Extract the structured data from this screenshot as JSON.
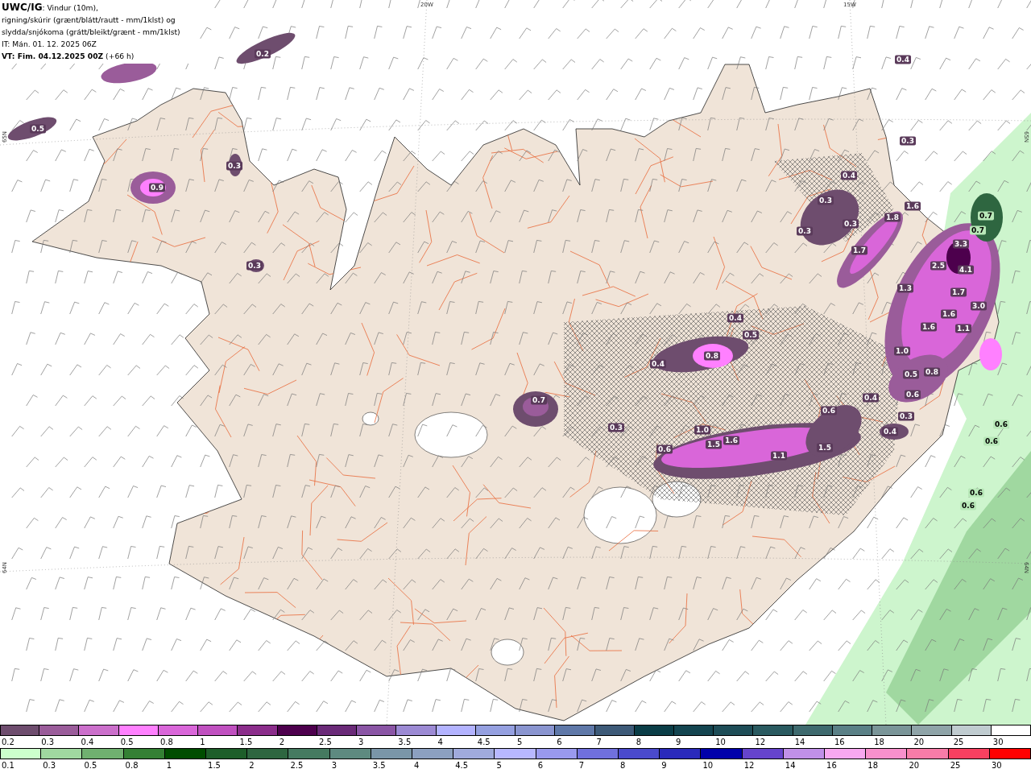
{
  "header": {
    "lines": [
      "**UWC/IG**: Vindur (10m),",
      "rigning/skúrir (grænt/blátt/rautt - mm/1klst) og",
      "slydda/snjókoma (grátt/bleikt/grænt - mm/1klst)",
      "IT: Mán. 01. 12. 2025 06Z",
      "**VT: Fim. 04.12.2025 00Z** (+66 h)"
    ]
  },
  "map": {
    "grid_labels": [
      {
        "text": "20W",
        "kind": "top"
      },
      {
        "text": "15W",
        "kind": "top"
      },
      {
        "text": "65N",
        "kind": "left"
      },
      {
        "text": "64N",
        "kind": "left"
      },
      {
        "text": "65N",
        "kind": "right"
      },
      {
        "text": "64N",
        "kind": "right"
      }
    ],
    "values": [
      {
        "value": "0.2",
        "kind": "snow"
      },
      {
        "value": "0.5",
        "kind": "snow"
      },
      {
        "value": "0.9",
        "kind": "snow"
      },
      {
        "value": "0.3",
        "kind": "snow"
      },
      {
        "value": "0.3",
        "kind": "snow"
      },
      {
        "value": "0.4",
        "kind": "snow"
      },
      {
        "value": "0.3",
        "kind": "snow"
      },
      {
        "value": "0.4",
        "kind": "snow"
      },
      {
        "value": "0.3",
        "kind": "snow"
      },
      {
        "value": "0.3",
        "kind": "snow"
      },
      {
        "value": "0.3",
        "kind": "snow"
      },
      {
        "value": "1.8",
        "kind": "snow"
      },
      {
        "value": "1.6",
        "kind": "snow"
      },
      {
        "value": "1.7",
        "kind": "snow"
      },
      {
        "value": "0.7",
        "kind": "rain"
      },
      {
        "value": "0.7",
        "kind": "rain"
      },
      {
        "value": "3.3",
        "kind": "snow"
      },
      {
        "value": "2.5",
        "kind": "snow"
      },
      {
        "value": "4.1",
        "kind": "snow"
      },
      {
        "value": "1.3",
        "kind": "snow"
      },
      {
        "value": "1.7",
        "kind": "snow"
      },
      {
        "value": "3.0",
        "kind": "snow"
      },
      {
        "value": "1.6",
        "kind": "snow"
      },
      {
        "value": "1.6",
        "kind": "snow"
      },
      {
        "value": "1.1",
        "kind": "snow"
      },
      {
        "value": "0.4",
        "kind": "snow"
      },
      {
        "value": "0.5",
        "kind": "snow"
      },
      {
        "value": "0.8",
        "kind": "snow"
      },
      {
        "value": "0.4",
        "kind": "snow"
      },
      {
        "value": "1.0",
        "kind": "snow"
      },
      {
        "value": "0.5",
        "kind": "snow"
      },
      {
        "value": "0.8",
        "kind": "snow"
      },
      {
        "value": "0.6",
        "kind": "snow"
      },
      {
        "value": "0.7",
        "kind": "snow"
      },
      {
        "value": "0.3",
        "kind": "snow"
      },
      {
        "value": "0.6",
        "kind": "snow"
      },
      {
        "value": "0.4",
        "kind": "snow"
      },
      {
        "value": "0.3",
        "kind": "snow"
      },
      {
        "value": "0.4",
        "kind": "snow"
      },
      {
        "value": "0.6",
        "kind": "rain"
      },
      {
        "value": "0.6",
        "kind": "rain"
      },
      {
        "value": "1.0",
        "kind": "snow"
      },
      {
        "value": "1.5",
        "kind": "snow"
      },
      {
        "value": "1.6",
        "kind": "snow"
      },
      {
        "value": "0.6",
        "kind": "snow"
      },
      {
        "value": "1.1",
        "kind": "snow"
      },
      {
        "value": "1.5",
        "kind": "snow"
      },
      {
        "value": "0.6",
        "kind": "rain"
      },
      {
        "value": "0.6",
        "kind": "rain"
      }
    ]
  },
  "legends": [
    {
      "items": [
        {
          "label": "0.2",
          "color": "#6e4d6e"
        },
        {
          "label": "0.3",
          "color": "#9a5c9a"
        },
        {
          "label": "0.4",
          "color": "#cb6fcb"
        },
        {
          "label": "0.5",
          "color": "#ff80ff"
        },
        {
          "label": "0.8",
          "color": "#d966d9"
        },
        {
          "label": "1",
          "color": "#c050c0"
        },
        {
          "label": "1.5",
          "color": "#8b2d8b"
        },
        {
          "label": "2",
          "color": "#4d004d"
        },
        {
          "label": "2.5",
          "color": "#6a2a78"
        },
        {
          "label": "3",
          "color": "#8a55a5"
        },
        {
          "label": "3.5",
          "color": "#9c8ad4"
        },
        {
          "label": "4",
          "color": "#b3b3ff"
        },
        {
          "label": "4.5",
          "color": "#95a0e0"
        },
        {
          "label": "5",
          "color": "#8a95d0"
        },
        {
          "label": "6",
          "color": "#5f78a8"
        },
        {
          "label": "7",
          "color": "#3d5a78"
        },
        {
          "label": "8",
          "color": "#0a3d47"
        },
        {
          "label": "9",
          "color": "#144550"
        },
        {
          "label": "10",
          "color": "#1e4d57"
        },
        {
          "label": "12",
          "color": "#2a5a60"
        },
        {
          "label": "14",
          "color": "#3e6a6e"
        },
        {
          "label": "16",
          "color": "#5a8086"
        },
        {
          "label": "18",
          "color": "#7a9598"
        },
        {
          "label": "20",
          "color": "#8fa4a8"
        },
        {
          "label": "25",
          "color": "#c0ccd0"
        },
        {
          "label": "30",
          "color": "#ffffff"
        }
      ]
    },
    {
      "items": [
        {
          "label": "0.1",
          "color": "#ccffcc"
        },
        {
          "label": "0.3",
          "color": "#a0d8a0"
        },
        {
          "label": "0.5",
          "color": "#70b070"
        },
        {
          "label": "0.8",
          "color": "#348034"
        },
        {
          "label": "1",
          "color": "#004d00"
        },
        {
          "label": "1.5",
          "color": "#1e5e2a"
        },
        {
          "label": "2",
          "color": "#2e6640"
        },
        {
          "label": "2.5",
          "color": "#457a60"
        },
        {
          "label": "3",
          "color": "#5e8a80"
        },
        {
          "label": "3.5",
          "color": "#7a96a8"
        },
        {
          "label": "4",
          "color": "#8ca0c0"
        },
        {
          "label": "4.5",
          "color": "#a0aadc"
        },
        {
          "label": "5",
          "color": "#b8b8ff"
        },
        {
          "label": "6",
          "color": "#9999ee"
        },
        {
          "label": "7",
          "color": "#7070dd"
        },
        {
          "label": "8",
          "color": "#4a4acc"
        },
        {
          "label": "9",
          "color": "#2a2abb"
        },
        {
          "label": "10",
          "color": "#0000aa"
        },
        {
          "label": "12",
          "color": "#6644cc"
        },
        {
          "label": "14",
          "color": "#c090e8"
        },
        {
          "label": "16",
          "color": "#f8a8f0"
        },
        {
          "label": "18",
          "color": "#f890cc"
        },
        {
          "label": "20",
          "color": "#f87ca8"
        },
        {
          "label": "25",
          "color": "#f84060"
        },
        {
          "label": "30",
          "color": "#ff0000"
        }
      ]
    }
  ]
}
